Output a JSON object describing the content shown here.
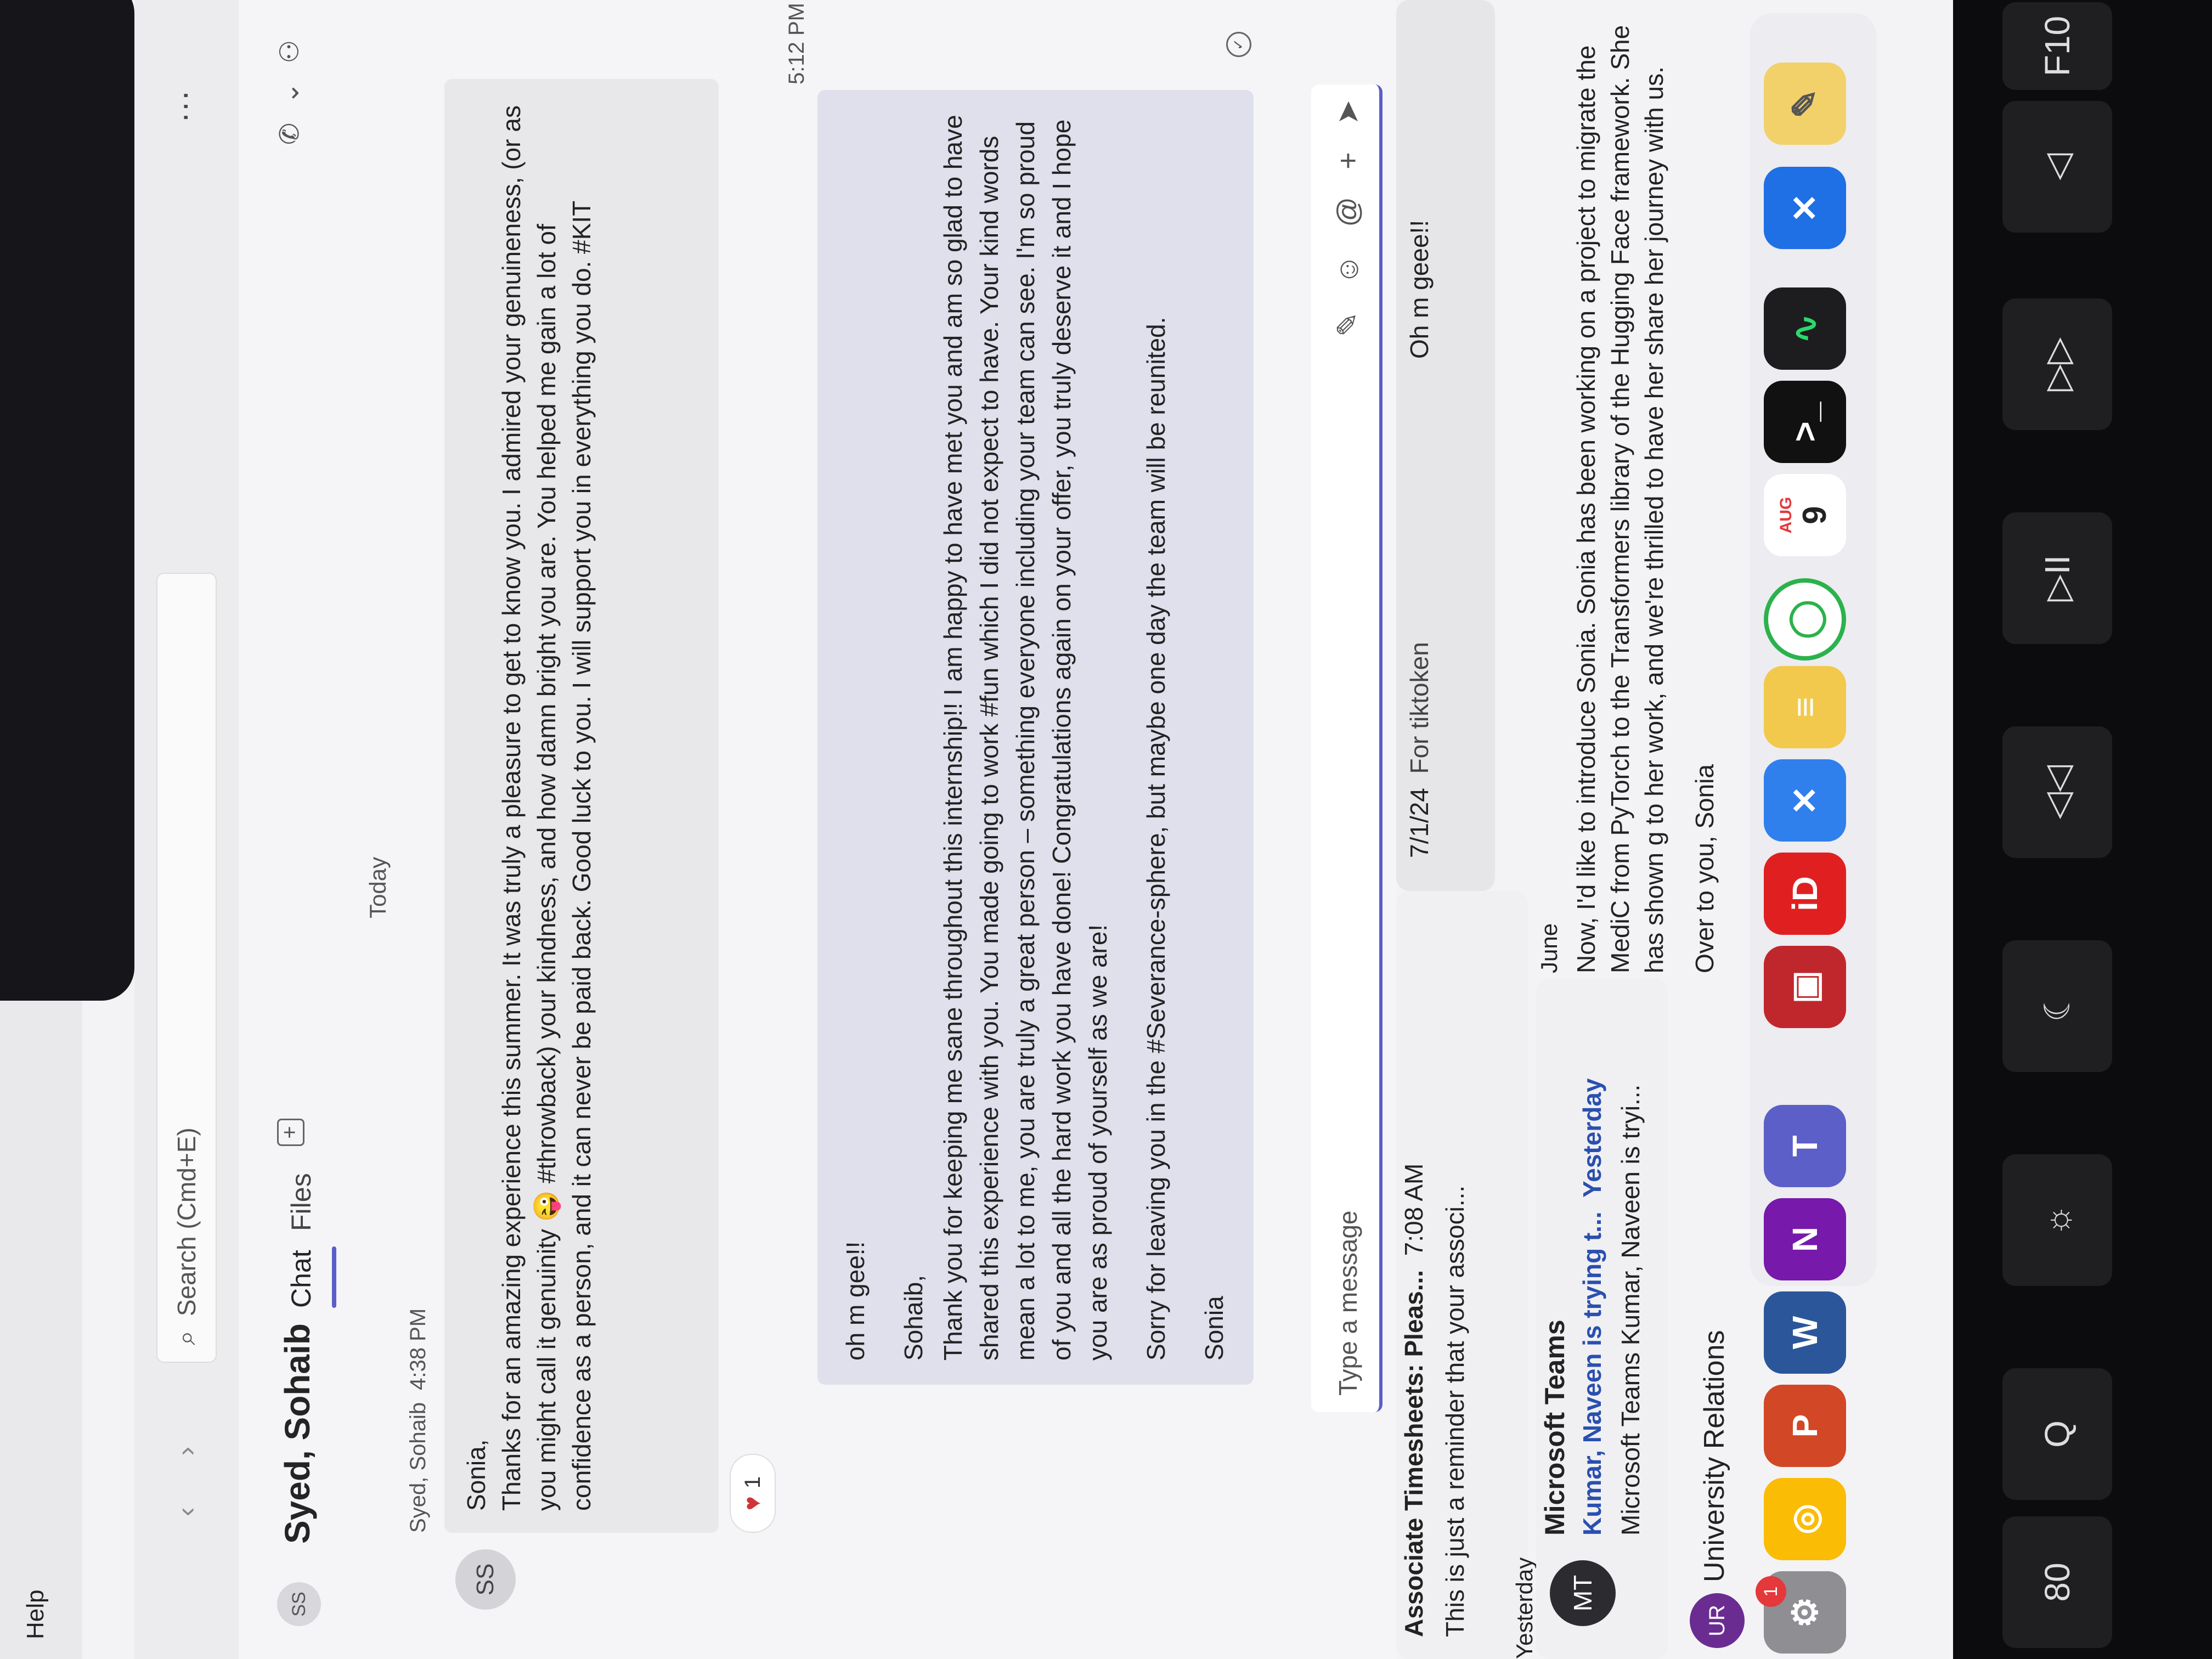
{
  "menubar": {
    "help": "Help",
    "icons": [
      "camera-icon",
      "cloud-icon",
      "onedrive-icon",
      "swirl-icon",
      "key-icon",
      "battery-icon"
    ]
  },
  "titlebar": {
    "search_placeholder": "Search (Cmd+E)",
    "more": "···",
    "initials": "SS"
  },
  "chat_header": {
    "avatar_initials": "SS",
    "name": "Syed, Sohaib",
    "tab_chat": "Chat",
    "tab_files": "Files",
    "add_tab": "+"
  },
  "conversation": {
    "day_divider": "Today",
    "incoming": {
      "sender": "Syed, Sohaib",
      "time": "4:38 PM",
      "avatar": "SS",
      "lines": [
        "Sonia,",
        "Thanks for an amazing experience this summer. It was truly a pleasure to get to know you. I admired your genuineness, (or as you might call it genuinity 😜 #throwback) your kindness, and how damn bright you are. You helped me gain a lot of confidence as a person, and it can never be paid back. Good luck to you. I will support you in everything you do. #KIT"
      ],
      "reaction_count": "1"
    },
    "outgoing": {
      "time": "5:12 PM",
      "paragraphs": [
        "oh m gee!!",
        "Sohaib,",
        "Thank you for keeping me sane throughout this internship!! I am happy to have met you and am so glad to have shared this experience with you. You made going to work #fun which I did not expect to have. Your kind words mean a lot to me, you are truly a great person – something everyone including your team can see. I'm so proud of you and all the hard work you have done! Congratulations again on your offer, you truly deserve it and I hope you are as proud of yourself as we are!",
        "Sorry for leaving you in the #Severance-sphere, but maybe one day the team will be reunited.",
        "Sonia"
      ]
    }
  },
  "composer": {
    "placeholder": "Type a message"
  },
  "notifications": {
    "n1_title": "Associate Timesheets: Pleas...",
    "n1_time": "7:08 AM",
    "n1_body": "This is just a reminder that your associ...",
    "n2_date": "7/1/24",
    "n2_body": "For tiktoken",
    "n2_reply": "Oh m geee!!",
    "yesterday": "Yesterday",
    "n3_avatar": "MT",
    "n3_title": "Microsoft Teams",
    "n3_sub": "Kumar, Naveen is trying t...",
    "n3_time": "Yesterday",
    "n3_body": "Microsoft Teams Kumar, Naveen is tryi...",
    "june": "June",
    "n4_body": "Now, I'd like to introduce Sonia. Sonia has been working on a project to migrate the MediC from PyTorch to the Transformers library of the Hugging Face framework. She has shown g to her work, and we're thrilled to have her share her journey with us.",
    "n4_more": "Over to you, Sonia",
    "n5_avatar": "UR",
    "n5_title": "University Relations"
  },
  "dock": {
    "badge": "1",
    "calendar_month": "AUG",
    "calendar_day": "9",
    "apps": [
      "system-settings-icon",
      "chrome-icon",
      "powerpoint-icon",
      "word-icon",
      "onenote-icon",
      "teams-icon",
      "photo-booth-icon",
      "id-app-icon",
      "vscode-icon",
      "notes-icon",
      "activity-icon",
      "calendar-icon",
      "terminal-icon",
      "activity-monitor-icon",
      "xcode-icon",
      "preview-icon",
      "finder-icon"
    ]
  },
  "keyboard": {
    "keys": [
      "80",
      "Q",
      "☼",
      "☾",
      "◁◁",
      "▷II",
      "▷▷",
      "◁",
      "F10"
    ]
  }
}
